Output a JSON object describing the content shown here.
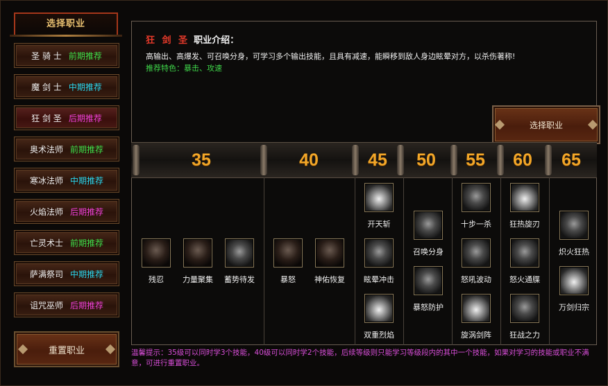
{
  "left": {
    "title": "选择职业",
    "classes": [
      {
        "name": "圣 骑 士",
        "tag": "前期推荐",
        "tag_color": "#3fe04a",
        "active": false
      },
      {
        "name": "魔 剑 士",
        "tag": "中期推荐",
        "tag_color": "#2ad8f0",
        "active": false
      },
      {
        "name": "狂 剑 圣",
        "tag": "后期推荐",
        "tag_color": "#f040d8",
        "active": true
      },
      {
        "name": "奥术法师",
        "tag": "前期推荐",
        "tag_color": "#3fe04a",
        "active": false
      },
      {
        "name": "寒冰法师",
        "tag": "中期推荐",
        "tag_color": "#2ad8f0",
        "active": false
      },
      {
        "name": "火焰法师",
        "tag": "后期推荐",
        "tag_color": "#f040d8",
        "active": false
      },
      {
        "name": "亡灵术士",
        "tag": "前期推荐",
        "tag_color": "#3fe04a",
        "active": false
      },
      {
        "name": "萨满祭司",
        "tag": "中期推荐",
        "tag_color": "#2ad8f0",
        "active": false
      },
      {
        "name": "诅咒巫师",
        "tag": "后期推荐",
        "tag_color": "#f040d8",
        "active": false
      }
    ],
    "reset_label": "重置职业"
  },
  "intro": {
    "class_name": "狂 剑 圣",
    "label": "职业介绍：",
    "description": "高输出、高爆发、可召唤分身，可学习多个输出技能，且具有减速，能瞬移到敌人身边眩晕对方，以杀伤著称!",
    "feature": "推荐特色：暴击、攻速"
  },
  "select_label": "选择职业",
  "levels": [
    "35",
    "40",
    "45",
    "50",
    "55",
    "60",
    "65"
  ],
  "skills": {
    "lv35": [
      "残忍",
      "力量聚集",
      "蓄势待发"
    ],
    "lv40": [
      "暴怒",
      "神佑恢复"
    ],
    "lv45": [
      "开天斩",
      "眩晕冲击",
      "双重烈焰"
    ],
    "lv50": [
      "召唤分身",
      "暴怒防护"
    ],
    "lv55": [
      "十步一杀",
      "怒吼波动",
      "旋涡剑阵"
    ],
    "lv60": [
      "狂热旋刃",
      "怒火通牒",
      "狂战之力"
    ],
    "lv65": [
      "炽火狂热",
      "万剑归宗"
    ]
  },
  "tip": "温馨提示：35级可以同时学3个技能，40级可以同时学2个技能，后续等级则只能学习等级段内的其中一个技能，如果对学习的技能或职业不满意，可进行重置职业。"
}
